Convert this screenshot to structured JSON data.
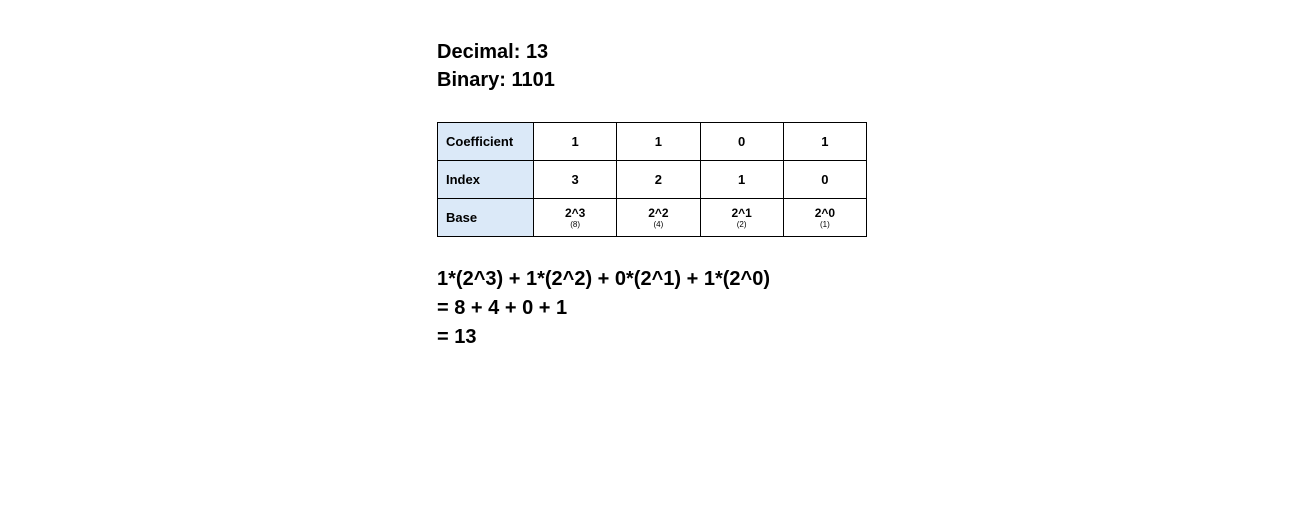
{
  "header": {
    "decimal_label": "Decimal:",
    "decimal_value": "13",
    "binary_label": "Binary:",
    "binary_value": "1101"
  },
  "table": {
    "rows": [
      {
        "label": "Coefficient",
        "cells": [
          "1",
          "1",
          "0",
          "1"
        ]
      },
      {
        "label": "Index",
        "cells": [
          "3",
          "2",
          "1",
          "0"
        ]
      }
    ],
    "base": {
      "label": "Base",
      "cells": [
        {
          "power": "2^3",
          "value": "(8)"
        },
        {
          "power": "2^2",
          "value": "(4)"
        },
        {
          "power": "2^1",
          "value": "(2)"
        },
        {
          "power": "2^0",
          "value": "(1)"
        }
      ]
    }
  },
  "calc": {
    "line1": "1*(2^3) + 1*(2^2) + 0*(2^1) + 1*(2^0)",
    "line2": "= 8 + 4 + 0 + 1",
    "line3": "= 13"
  }
}
